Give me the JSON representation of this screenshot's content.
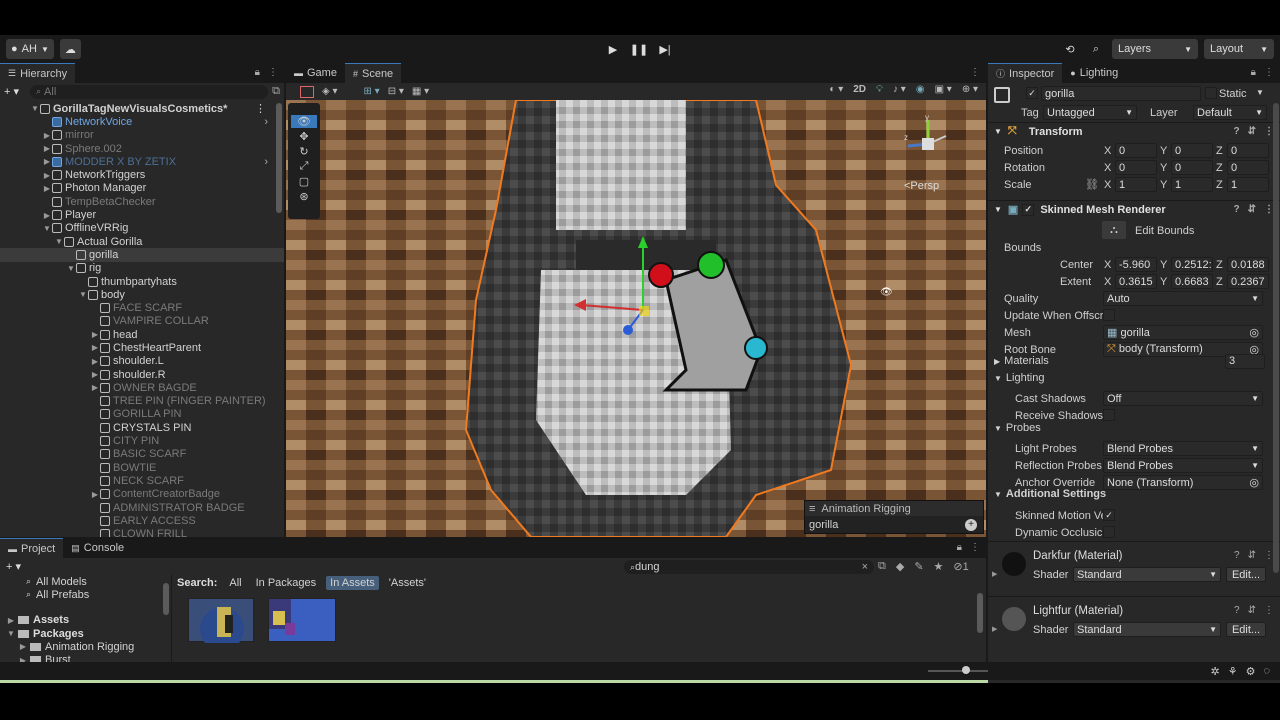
{
  "toolbar": {
    "account": "AH",
    "layers": "Layers",
    "layout": "Layout"
  },
  "hierarchy": {
    "tab": "Hierarchy",
    "search_placeholder": "All",
    "items": [
      {
        "label": "GorillaTagNewVisualsCosmetics*",
        "indent": 0,
        "style": "bold",
        "arrow": "▼"
      },
      {
        "label": "NetworkVoice",
        "indent": 1,
        "style": "blue",
        "arrow": ""
      },
      {
        "label": "mirror",
        "indent": 1,
        "style": "muted",
        "arrow": "▶"
      },
      {
        "label": "Sphere.002",
        "indent": 1,
        "style": "muted",
        "arrow": "▶"
      },
      {
        "label": "MODDER X BY ZETIX",
        "indent": 1,
        "style": "blue-muted",
        "arrow": "▶"
      },
      {
        "label": "NetworkTriggers",
        "indent": 1,
        "style": "",
        "arrow": "▶"
      },
      {
        "label": "Photon Manager",
        "indent": 1,
        "style": "",
        "arrow": "▶"
      },
      {
        "label": "TempBetaChecker",
        "indent": 1,
        "style": "muted",
        "arrow": ""
      },
      {
        "label": "Player",
        "indent": 1,
        "style": "",
        "arrow": "▶"
      },
      {
        "label": "OfflineVRRig",
        "indent": 1,
        "style": "",
        "arrow": "▼"
      },
      {
        "label": "Actual Gorilla",
        "indent": 2,
        "style": "",
        "arrow": "▼"
      },
      {
        "label": "gorilla",
        "indent": 3,
        "style": "selected",
        "arrow": ""
      },
      {
        "label": "rig",
        "indent": 3,
        "style": "",
        "arrow": "▼"
      },
      {
        "label": "thumbpartyhats",
        "indent": 4,
        "style": "",
        "arrow": ""
      },
      {
        "label": "body",
        "indent": 4,
        "style": "",
        "arrow": "▼"
      },
      {
        "label": "FACE SCARF",
        "indent": 5,
        "style": "muted",
        "arrow": ""
      },
      {
        "label": "VAMPIRE COLLAR",
        "indent": 5,
        "style": "muted",
        "arrow": ""
      },
      {
        "label": "head",
        "indent": 5,
        "style": "",
        "arrow": "▶"
      },
      {
        "label": "ChestHeartParent",
        "indent": 5,
        "style": "",
        "arrow": "▶"
      },
      {
        "label": "shoulder.L",
        "indent": 5,
        "style": "",
        "arrow": "▶"
      },
      {
        "label": "shoulder.R",
        "indent": 5,
        "style": "",
        "arrow": "▶"
      },
      {
        "label": "OWNER BAGDE",
        "indent": 5,
        "style": "muted",
        "arrow": "▶"
      },
      {
        "label": "TREE PIN (FINGER PAINTER)",
        "indent": 5,
        "style": "muted",
        "arrow": ""
      },
      {
        "label": "GORILLA PIN",
        "indent": 5,
        "style": "muted",
        "arrow": ""
      },
      {
        "label": "CRYSTALS PIN",
        "indent": 5,
        "style": "",
        "arrow": ""
      },
      {
        "label": "CITY PIN",
        "indent": 5,
        "style": "muted",
        "arrow": ""
      },
      {
        "label": "BASIC SCARF",
        "indent": 5,
        "style": "muted",
        "arrow": ""
      },
      {
        "label": "BOWTIE",
        "indent": 5,
        "style": "muted",
        "arrow": ""
      },
      {
        "label": "NECK SCARF",
        "indent": 5,
        "style": "muted",
        "arrow": ""
      },
      {
        "label": "ContentCreatorBadge",
        "indent": 5,
        "style": "muted",
        "arrow": "▶"
      },
      {
        "label": "ADMINISTRATOR BADGE",
        "indent": 5,
        "style": "muted",
        "arrow": ""
      },
      {
        "label": "EARLY ACCESS",
        "indent": 5,
        "style": "muted",
        "arrow": ""
      },
      {
        "label": "CLOWN FRILL",
        "indent": 5,
        "style": "muted",
        "arrow": ""
      }
    ]
  },
  "scene_view": {
    "tab_game": "Game",
    "tab_scene": "Scene",
    "mode_2d": "2D",
    "persp": "<Persp",
    "overlay_title": "Animation Rigging",
    "overlay_value": "gorilla"
  },
  "inspector": {
    "tab_inspector": "Inspector",
    "tab_lighting": "Lighting",
    "object_name": "gorilla",
    "static_label": "Static",
    "tag_label": "Tag",
    "tag_value": "Untagged",
    "layer_label": "Layer",
    "layer_value": "Default",
    "transform": {
      "title": "Transform",
      "position_label": "Position",
      "rotation_label": "Rotation",
      "scale_label": "Scale",
      "position": {
        "x": "0",
        "y": "0",
        "z": "0"
      },
      "rotation": {
        "x": "0",
        "y": "0",
        "z": "0"
      },
      "scale": {
        "x": "1",
        "y": "1",
        "z": "1"
      }
    },
    "smr": {
      "title": "Skinned Mesh Renderer",
      "edit_bounds": "Edit Bounds",
      "bounds_label": "Bounds",
      "center_label": "Center",
      "extent_label": "Extent",
      "center": {
        "x": "-5.960",
        "y": "0.2512:",
        "z": "0.0188"
      },
      "extent": {
        "x": "0.3615",
        "y": "0.6683",
        "z": "0.2367"
      },
      "quality_label": "Quality",
      "quality_value": "Auto",
      "update_offscreen_label": "Update When Offscre",
      "mesh_label": "Mesh",
      "mesh_value": "gorilla",
      "root_bone_label": "Root Bone",
      "root_bone_value": "body (Transform)",
      "materials_label": "Materials",
      "materials_count": "3",
      "lighting_label": "Lighting",
      "cast_shadows_label": "Cast Shadows",
      "cast_shadows_value": "Off",
      "receive_shadows_label": "Receive Shadows",
      "probes_label": "Probes",
      "light_probes_label": "Light Probes",
      "light_probes_value": "Blend Probes",
      "reflection_probes_label": "Reflection Probes",
      "reflection_probes_value": "Blend Probes",
      "anchor_override_label": "Anchor Override",
      "anchor_override_value": "None (Transform)",
      "additional_label": "Additional Settings",
      "skinned_motion_label": "Skinned Motion Ve",
      "dynamic_occlusion_label": "Dynamic Occlusic"
    },
    "materials": [
      {
        "name": "Darkfur (Material)",
        "shader_label": "Shader",
        "shader": "Standard",
        "edit": "Edit..."
      },
      {
        "name": "Lightfur (Material)",
        "shader_label": "Shader",
        "shader": "Standard",
        "edit": "Edit..."
      }
    ]
  },
  "project": {
    "tab_project": "Project",
    "tab_console": "Console",
    "search_value": "dung",
    "favorites": [
      "All Models",
      "All Prefabs"
    ],
    "tree": [
      {
        "label": "Assets",
        "indent": 0,
        "arrow": "▶"
      },
      {
        "label": "Packages",
        "indent": 0,
        "arrow": "▼"
      },
      {
        "label": "Animation Rigging",
        "indent": 1,
        "arrow": "▶"
      },
      {
        "label": "Burst",
        "indent": 1,
        "arrow": "▶"
      }
    ],
    "search_label": "Search:",
    "scopes": [
      "All",
      "In Packages",
      "In Assets",
      "'Assets'"
    ],
    "selected_scope": "In Assets"
  },
  "colors": {
    "accent": "#3a79bb",
    "selection_outline": "#f07a1f",
    "bg": "#191919",
    "panel": "#282828"
  }
}
